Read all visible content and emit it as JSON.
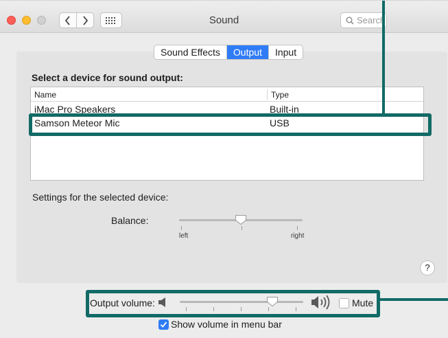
{
  "window": {
    "title": "Sound",
    "search_placeholder": "Search",
    "search_display": "Search"
  },
  "tabs": [
    {
      "label": "Sound Effects",
      "active": false
    },
    {
      "label": "Output",
      "active": true
    },
    {
      "label": "Input",
      "active": false
    }
  ],
  "output": {
    "section_title": "Select a device for sound output:",
    "columns": {
      "name": "Name",
      "type": "Type"
    },
    "devices": [
      {
        "name": "iMac Pro Speakers",
        "type": "Built-in"
      },
      {
        "name": "Samson Meteor Mic",
        "type": "USB"
      }
    ],
    "settings_label": "Settings for the selected device:",
    "balance": {
      "label": "Balance:",
      "left_label": "left",
      "right_label": "right",
      "value": 0.5
    },
    "help": "?"
  },
  "volume": {
    "label": "Output volume:",
    "value": 0.75,
    "mute_label": "Mute",
    "mute_checked": false,
    "show_in_menu_bar_label": "Show volume in menu bar",
    "show_in_menu_bar_checked": true
  },
  "colors": {
    "accent": "#2f7cf6",
    "annotation": "#126a66"
  },
  "icons": {
    "speaker_low": "speaker-low-icon",
    "speaker_high": "speaker-high-icon",
    "search": "search-icon",
    "grid": "grid-icon"
  }
}
